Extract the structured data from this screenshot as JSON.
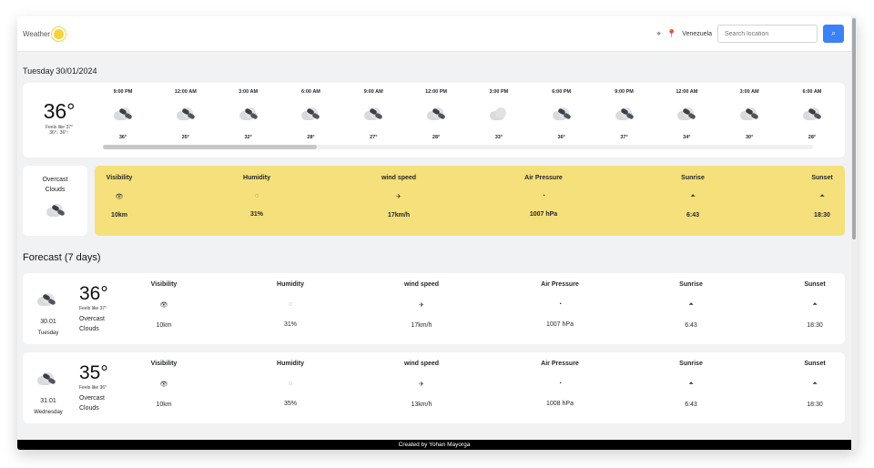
{
  "brand": {
    "name": "Weather",
    "icon": "sun-icon"
  },
  "location": {
    "country": "Venezuela",
    "placeholder": "Search location"
  },
  "today": {
    "day": "Tuesday",
    "date": "30/01/2024"
  },
  "current": {
    "temp": "36°",
    "feels": "Feels like 37°",
    "range": "36°↓ 36°↑",
    "condition_line1": "Overcast",
    "condition_line2": "Clouds"
  },
  "hourly": [
    {
      "time": "9:00 PM",
      "temp": "36°"
    },
    {
      "time": "12:00 AM",
      "temp": "35°"
    },
    {
      "time": "3:00 AM",
      "temp": "32°"
    },
    {
      "time": "6:00 AM",
      "temp": "28°"
    },
    {
      "time": "9:00 AM",
      "temp": "27°"
    },
    {
      "time": "12:00 PM",
      "temp": "28°"
    },
    {
      "time": "3:00 PM",
      "temp": "33°"
    },
    {
      "time": "6:00 PM",
      "temp": "36°"
    },
    {
      "time": "9:00 PM",
      "temp": "37°"
    },
    {
      "time": "12:00 AM",
      "temp": "34°"
    },
    {
      "time": "3:00 AM",
      "temp": "30°"
    },
    {
      "time": "6:00 AM",
      "temp": "28°"
    }
  ],
  "details": {
    "visibility": {
      "label": "Visibility",
      "value": "10km",
      "icon": "eye-icon"
    },
    "humidity": {
      "label": "Humidity",
      "value": "31%",
      "icon": "droplet-icon"
    },
    "wind": {
      "label": "wind speed",
      "value": "17km/h",
      "icon": "wind-icon"
    },
    "pressure": {
      "label": "Air Pressure",
      "value": "1007 hPa",
      "icon": "gauge-icon"
    },
    "sunrise": {
      "label": "Sunrise",
      "value": "6:43",
      "icon": "sunrise-icon"
    },
    "sunset": {
      "label": "Sunset",
      "value": "18:30",
      "icon": "sunset-icon"
    }
  },
  "forecast_heading": "Forecast (7 days)",
  "forecast": [
    {
      "date": "30.01",
      "day": "Tuesday",
      "temp": "36°",
      "feels": "Feels like 37°",
      "cond1": "Overcast",
      "cond2": "Clouds",
      "visibility": "10km",
      "humidity": "31%",
      "wind": "17km/h",
      "pressure": "1007 hPa",
      "sunrise": "6:43",
      "sunset": "18:30"
    },
    {
      "date": "31.01",
      "day": "Wednesday",
      "temp": "35°",
      "feels": "Feels like 36°",
      "cond1": "Overcast",
      "cond2": "Clouds",
      "visibility": "10km",
      "humidity": "35%",
      "wind": "13km/h",
      "pressure": "1008 hPa",
      "sunrise": "6:43",
      "sunset": "18:30"
    }
  ],
  "footer": "Created by Yohan Mayorga",
  "colors": {
    "accent": "#3b82f6",
    "details_bg": "#f6e07b",
    "sun": "#f7d23a"
  }
}
